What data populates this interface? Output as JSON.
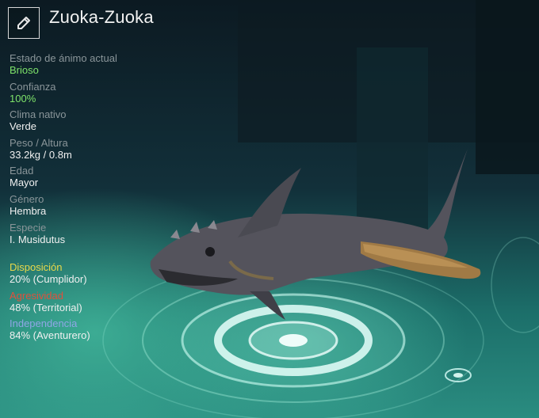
{
  "creature": {
    "name": "Zuoka-Zuoka"
  },
  "icons": {
    "edit": "pencil-icon"
  },
  "stats": [
    {
      "label": "Estado de ánimo actual",
      "value": "Brioso",
      "highlight": true
    },
    {
      "label": "Confianza",
      "value": "100%",
      "highlight": true
    },
    {
      "label": "Clima nativo",
      "value": "Verde",
      "highlight": false
    },
    {
      "label": "Peso / Altura",
      "value": "33.2kg / 0.8m",
      "highlight": false
    },
    {
      "label": "Edad",
      "value": "Mayor",
      "highlight": false
    },
    {
      "label": "Género",
      "value": "Hembra",
      "highlight": false
    },
    {
      "label": "Especie",
      "value": "I. Musidutus",
      "highlight": false
    }
  ],
  "traits": [
    {
      "label": "Disposición",
      "value": "20% (Cumplidor)",
      "color": "#e8d84a"
    },
    {
      "label": "Agresividad",
      "value": "48% (Territorial)",
      "color": "#e0503c"
    },
    {
      "label": "Independencia",
      "value": "84% (Aventurero)",
      "color": "#8fa6e6"
    }
  ],
  "colors": {
    "highlight_value": "#7ee36a",
    "label": "#8a9599",
    "value": "#f0f0f0"
  }
}
